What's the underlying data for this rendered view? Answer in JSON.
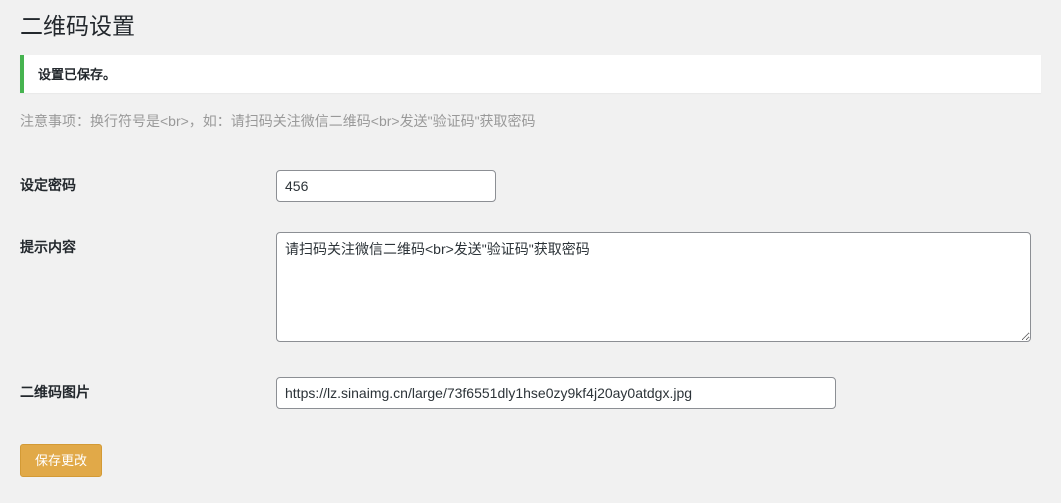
{
  "page": {
    "title": "二维码设置"
  },
  "notice": {
    "message": "设置已保存。"
  },
  "helper": "注意事项：换行符号是<br>，如：请扫码关注微信二维码<br>发送\"验证码\"获取密码",
  "form": {
    "password_label": "设定密码",
    "password_value": "456",
    "tip_label": "提示内容",
    "tip_value": "请扫码关注微信二维码<br>发送\"验证码\"获取密码",
    "qr_label": "二维码图片",
    "qr_value": "https://lz.sinaimg.cn/large/73f6551dly1hse0zy9kf4j20ay0atdgx.jpg",
    "submit_label": "保存更改"
  }
}
